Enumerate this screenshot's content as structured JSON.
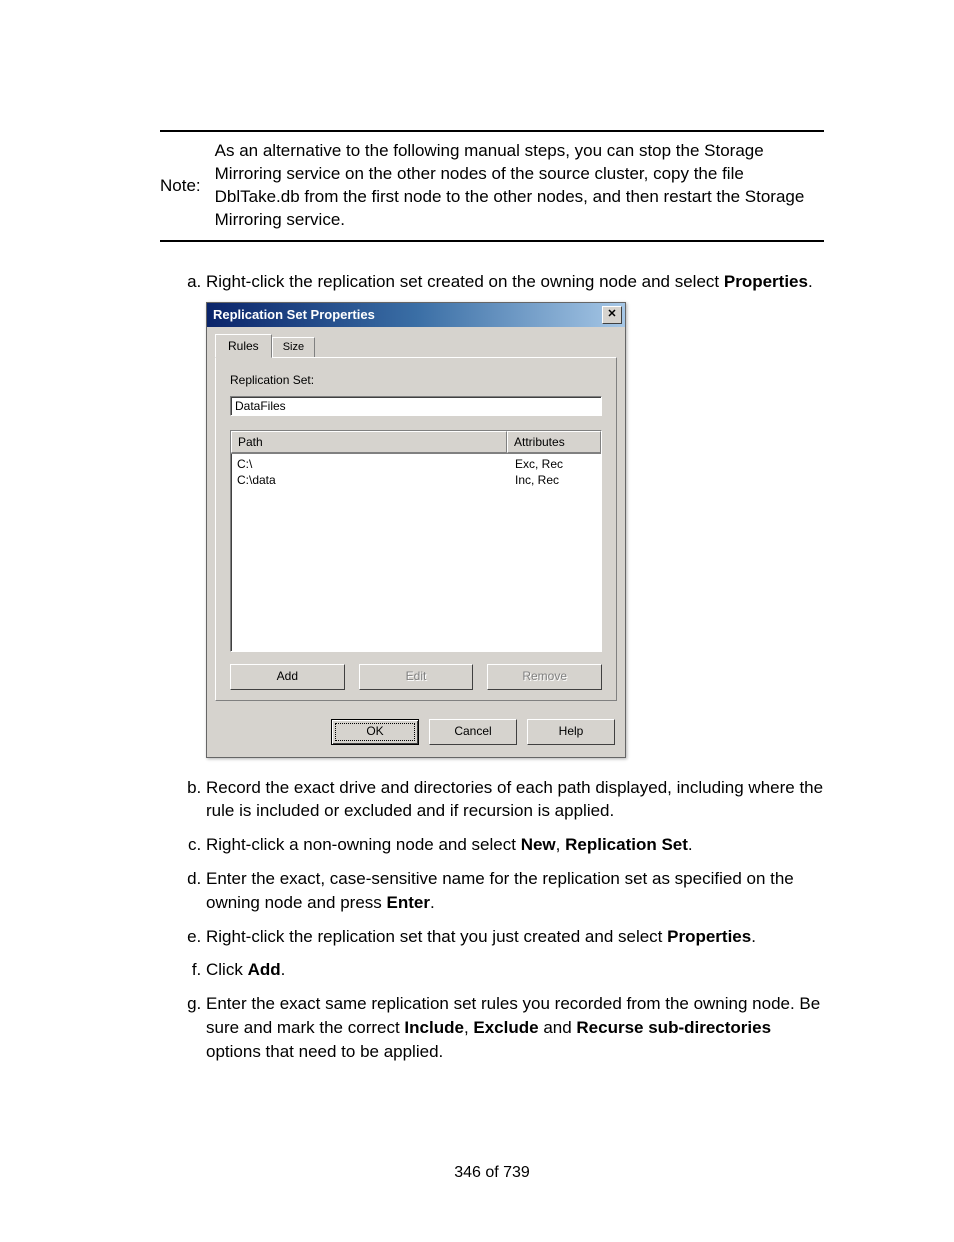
{
  "note": {
    "label": "Note:",
    "text": "As an alternative to the following manual steps, you can stop the Storage Mirroring service on the other nodes of the source cluster, copy the file DblTake.db from the first node to the other nodes, and then restart the Storage Mirroring service."
  },
  "steps": {
    "a": {
      "pre": "Right-click the replication set created on the owning node and select ",
      "b1": "Properties",
      "post": "."
    },
    "b": "Record the exact drive and directories of each path displayed, including where the rule is included or excluded and if recursion is applied.",
    "c": {
      "pre": "Right-click a non-owning node and select ",
      "b1": "New",
      "mid": ", ",
      "b2": "Replication Set",
      "post": "."
    },
    "d": {
      "pre": "Enter the exact, case-sensitive name for the replication set as specified on the owning node and press ",
      "b1": "Enter",
      "post": "."
    },
    "e": {
      "pre": "Right-click the replication set that you just created and select ",
      "b1": "Properties",
      "post": "."
    },
    "f": {
      "pre": "Click ",
      "b1": "Add",
      "post": "."
    },
    "g": {
      "pre": "Enter the exact same replication set rules you recorded from the owning node. Be sure and mark the correct ",
      "b1": "Include",
      "mid1": ", ",
      "b2": "Exclude",
      "mid2": " and ",
      "b3": "Recurse sub-directories",
      "post": " options that need to be applied."
    }
  },
  "dialog": {
    "title": "Replication Set Properties",
    "close": "✕",
    "tabs": {
      "rules": "Rules",
      "size": "Size"
    },
    "field_label": "Replication Set:",
    "replication_set_value": "DataFiles",
    "columns": {
      "path": "Path",
      "attr": "Attributes"
    },
    "rows": [
      {
        "path": "C:\\",
        "attr": "Exc, Rec"
      },
      {
        "path": "C:\\data",
        "attr": "Inc, Rec"
      }
    ],
    "buttons": {
      "add": "Add",
      "edit": "Edit",
      "remove": "Remove"
    },
    "footer": {
      "ok": "OK",
      "cancel": "Cancel",
      "help": "Help"
    }
  },
  "page_number": "346 of 739"
}
